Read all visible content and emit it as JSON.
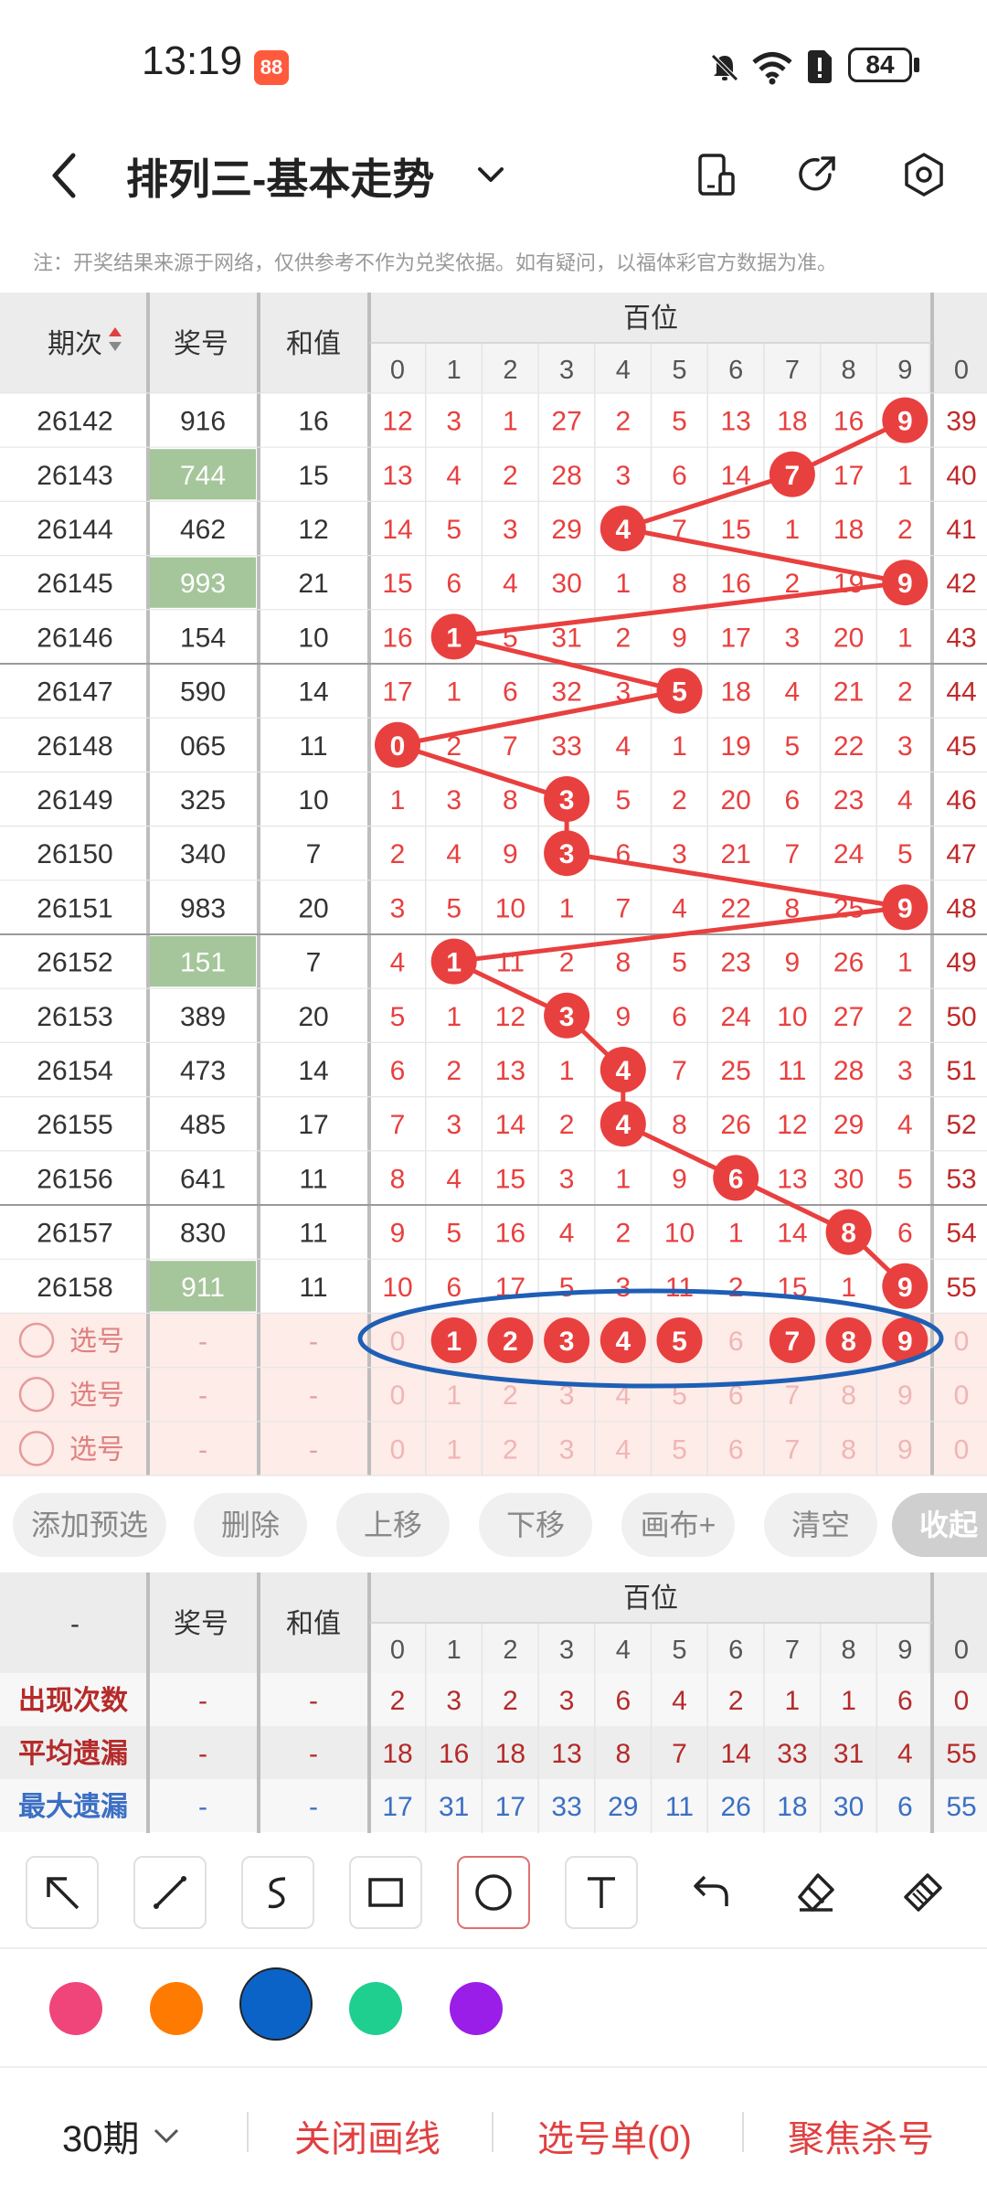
{
  "status_bar": {
    "time": "13:19",
    "app_badge": "88",
    "battery": "84"
  },
  "header": {
    "title": "排列三-基本走势",
    "icons": [
      "back-icon",
      "chevron-down-icon",
      "phone-icon",
      "share-icon",
      "settings-icon"
    ]
  },
  "note": "注：开奖结果来源于网络，仅供参考不作为兑奖依据。如有疑问，以福体彩官方数据为准。",
  "table": {
    "col_issue": "期次",
    "col_prize": "奖号",
    "col_sum": "和值",
    "group_label": "百位",
    "digits": [
      "0",
      "1",
      "2",
      "3",
      "4",
      "5",
      "6",
      "7",
      "8",
      "9"
    ],
    "extra_col": "0",
    "rows": [
      {
        "issue": "26142",
        "prize": "916",
        "sum": "16",
        "cells": [
          "12",
          "3",
          "1",
          "27",
          "2",
          "5",
          "13",
          "18",
          "16",
          "9"
        ],
        "hit": 9,
        "extra": "39",
        "hl": false
      },
      {
        "issue": "26143",
        "prize": "744",
        "sum": "15",
        "cells": [
          "13",
          "4",
          "2",
          "28",
          "3",
          "6",
          "14",
          "7",
          "17",
          "1"
        ],
        "hit": 7,
        "extra": "40",
        "hl": true
      },
      {
        "issue": "26144",
        "prize": "462",
        "sum": "12",
        "cells": [
          "14",
          "5",
          "3",
          "29",
          "4",
          "7",
          "15",
          "1",
          "18",
          "2"
        ],
        "hit": 4,
        "extra": "41",
        "hl": false
      },
      {
        "issue": "26145",
        "prize": "993",
        "sum": "21",
        "cells": [
          "15",
          "6",
          "4",
          "30",
          "1",
          "8",
          "16",
          "2",
          "19",
          "9"
        ],
        "hit": 9,
        "extra": "42",
        "hl": true
      },
      {
        "issue": "26146",
        "prize": "154",
        "sum": "10",
        "cells": [
          "16",
          "1",
          "5",
          "31",
          "2",
          "9",
          "17",
          "3",
          "20",
          "1"
        ],
        "hit": 1,
        "extra": "43",
        "hl": false
      },
      {
        "issue": "26147",
        "prize": "590",
        "sum": "14",
        "cells": [
          "17",
          "1",
          "6",
          "32",
          "3",
          "5",
          "18",
          "4",
          "21",
          "2"
        ],
        "hit": 5,
        "extra": "44",
        "hl": false
      },
      {
        "issue": "26148",
        "prize": "065",
        "sum": "11",
        "cells": [
          "0",
          "2",
          "7",
          "33",
          "4",
          "1",
          "19",
          "5",
          "22",
          "3"
        ],
        "hit": 0,
        "extra": "45",
        "hl": false
      },
      {
        "issue": "26149",
        "prize": "325",
        "sum": "10",
        "cells": [
          "1",
          "3",
          "8",
          "3",
          "5",
          "2",
          "20",
          "6",
          "23",
          "4"
        ],
        "hit": 3,
        "extra": "46",
        "hl": false
      },
      {
        "issue": "26150",
        "prize": "340",
        "sum": "7",
        "cells": [
          "2",
          "4",
          "9",
          "3",
          "6",
          "3",
          "21",
          "7",
          "24",
          "5"
        ],
        "hit": 3,
        "extra": "47",
        "hl": false
      },
      {
        "issue": "26151",
        "prize": "983",
        "sum": "20",
        "cells": [
          "3",
          "5",
          "10",
          "1",
          "7",
          "4",
          "22",
          "8",
          "25",
          "9"
        ],
        "hit": 9,
        "extra": "48",
        "hl": false
      },
      {
        "issue": "26152",
        "prize": "151",
        "sum": "7",
        "cells": [
          "4",
          "1",
          "11",
          "2",
          "8",
          "5",
          "23",
          "9",
          "26",
          "1"
        ],
        "hit": 1,
        "extra": "49",
        "hl": true
      },
      {
        "issue": "26153",
        "prize": "389",
        "sum": "20",
        "cells": [
          "5",
          "1",
          "12",
          "3",
          "9",
          "6",
          "24",
          "10",
          "27",
          "2"
        ],
        "hit": 3,
        "extra": "50",
        "hl": false
      },
      {
        "issue": "26154",
        "prize": "473",
        "sum": "14",
        "cells": [
          "6",
          "2",
          "13",
          "1",
          "4",
          "7",
          "25",
          "11",
          "28",
          "3"
        ],
        "hit": 4,
        "extra": "51",
        "hl": false
      },
      {
        "issue": "26155",
        "prize": "485",
        "sum": "17",
        "cells": [
          "7",
          "3",
          "14",
          "2",
          "4",
          "8",
          "26",
          "12",
          "29",
          "4"
        ],
        "hit": 4,
        "extra": "52",
        "hl": false
      },
      {
        "issue": "26156",
        "prize": "641",
        "sum": "11",
        "cells": [
          "8",
          "4",
          "15",
          "3",
          "1",
          "9",
          "6",
          "13",
          "30",
          "5"
        ],
        "hit": 6,
        "extra": "53",
        "hl": false
      },
      {
        "issue": "26157",
        "prize": "830",
        "sum": "11",
        "cells": [
          "9",
          "5",
          "16",
          "4",
          "2",
          "10",
          "1",
          "14",
          "8",
          "6"
        ],
        "hit": 8,
        "extra": "54",
        "hl": false
      },
      {
        "issue": "26158",
        "prize": "911",
        "sum": "11",
        "cells": [
          "10",
          "6",
          "17",
          "5",
          "3",
          "11",
          "2",
          "15",
          "1",
          "9"
        ],
        "hit": 9,
        "extra": "55",
        "hl": true
      }
    ],
    "select_rows": [
      {
        "label": "选号",
        "prize": "-",
        "sum": "-",
        "cells": [
          "0",
          "1",
          "2",
          "3",
          "4",
          "5",
          "6",
          "7",
          "8",
          "9"
        ],
        "hits": [
          1,
          2,
          3,
          4,
          5,
          7,
          8,
          9
        ],
        "extra": "0"
      },
      {
        "label": "选号",
        "prize": "-",
        "sum": "-",
        "cells": [
          "0",
          "1",
          "2",
          "3",
          "4",
          "5",
          "6",
          "7",
          "8",
          "9"
        ],
        "hits": [],
        "extra": "0"
      },
      {
        "label": "选号",
        "prize": "-",
        "sum": "-",
        "cells": [
          "0",
          "1",
          "2",
          "3",
          "4",
          "5",
          "6",
          "7",
          "8",
          "9"
        ],
        "hits": [],
        "extra": "0"
      }
    ]
  },
  "buttons": [
    "添加预选",
    "删除",
    "上移",
    "下移",
    "画布+",
    "清空",
    "收起"
  ],
  "stats": {
    "corner": "-",
    "col_prize": "奖号",
    "col_sum": "和值",
    "group_label": "百位",
    "digits": [
      "0",
      "1",
      "2",
      "3",
      "4",
      "5",
      "6",
      "7",
      "8",
      "9"
    ],
    "extra_col": "0",
    "rows": [
      {
        "label": "出现次数",
        "prize": "-",
        "sum": "-",
        "cells": [
          "2",
          "3",
          "2",
          "3",
          "6",
          "4",
          "2",
          "1",
          "1",
          "6"
        ],
        "extra": "0",
        "color": "#b52a2a"
      },
      {
        "label": "平均遗漏",
        "prize": "-",
        "sum": "-",
        "cells": [
          "18",
          "16",
          "18",
          "13",
          "8",
          "7",
          "14",
          "33",
          "31",
          "4"
        ],
        "extra": "55",
        "color": "#b52a2a"
      },
      {
        "label": "最大遗漏",
        "prize": "-",
        "sum": "-",
        "cells": [
          "17",
          "31",
          "17",
          "33",
          "29",
          "11",
          "26",
          "18",
          "30",
          "6"
        ],
        "extra": "55",
        "color": "#3b6fc4"
      }
    ]
  },
  "tools": [
    "arrow-tool-icon",
    "line-tool-icon",
    "curve-tool-icon",
    "rect-tool-icon",
    "circle-tool-icon",
    "text-tool-icon",
    "undo-icon",
    "eraser-icon",
    "clear-brush-icon"
  ],
  "palette": [
    "#f0457a",
    "#ff7a00",
    "#0b63c8",
    "#1fcf8f",
    "#9a1ee8"
  ],
  "bottom_bar": {
    "period": "30期",
    "close_draw": "关闭画线",
    "select_list": "选号单(0)",
    "focus_kill": "聚焦杀号"
  },
  "colors": {
    "accent_red": "#e8403f",
    "highlight_green": "#a5c59a",
    "ellipse_blue": "#1e5fb5"
  }
}
